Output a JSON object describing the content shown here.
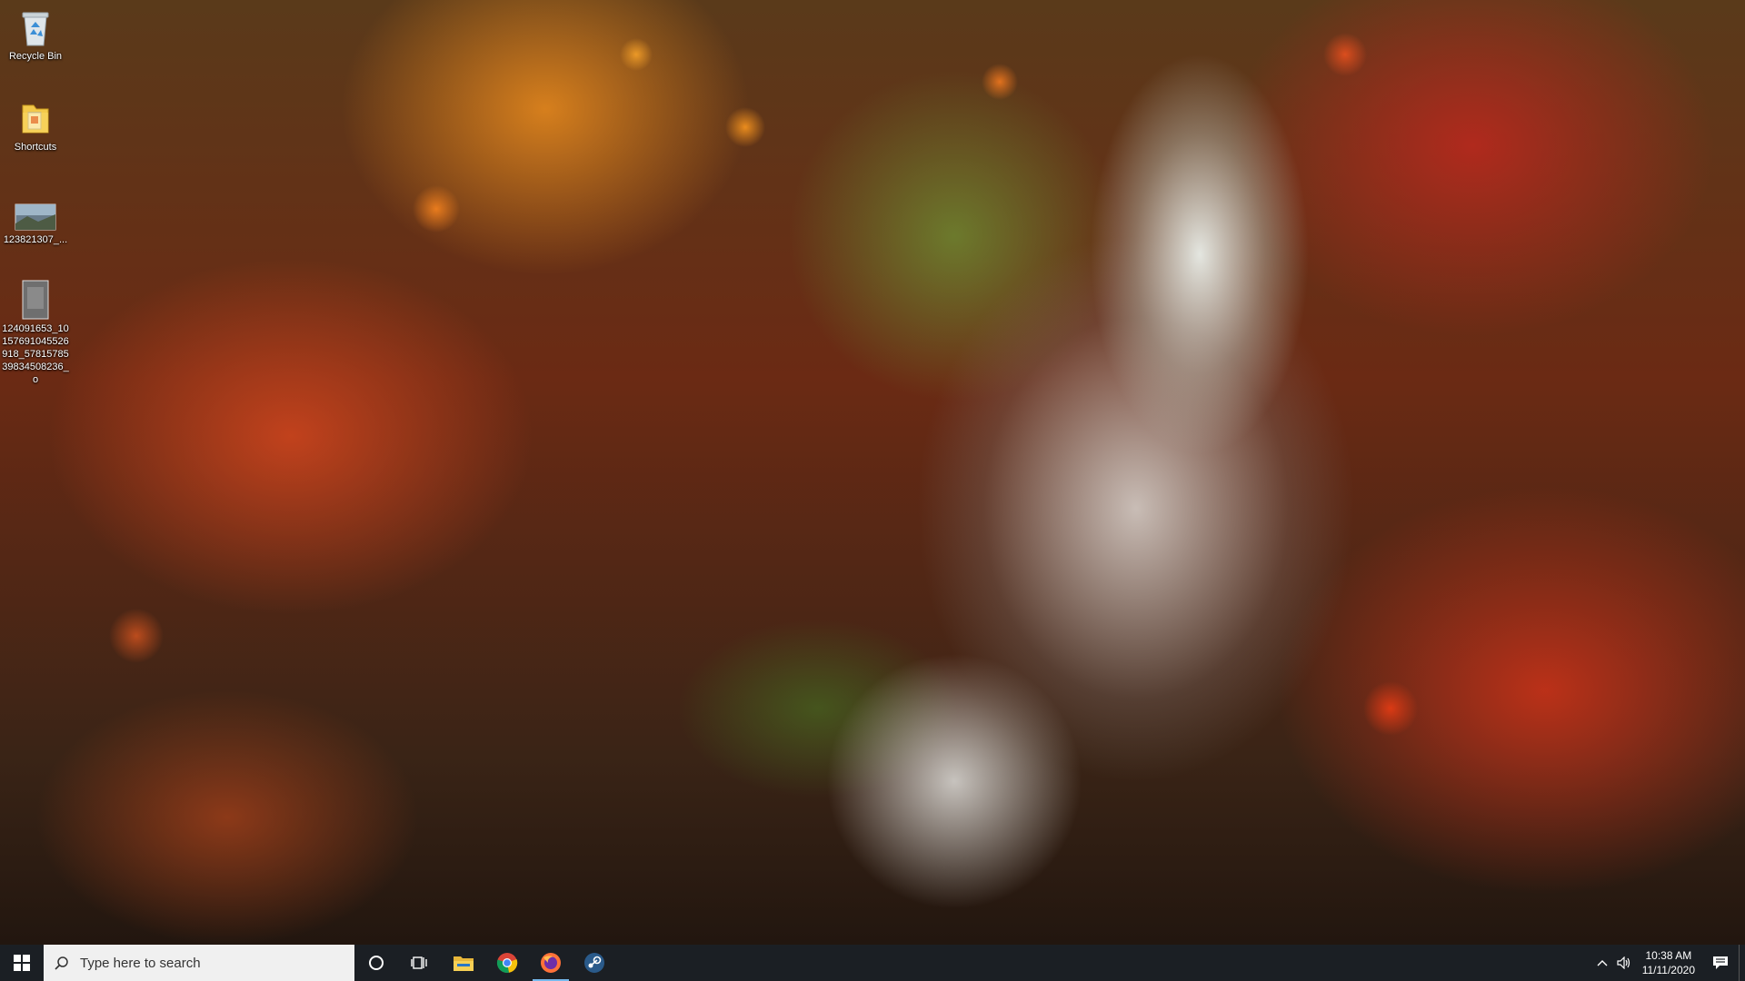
{
  "desktop": {
    "icons": [
      {
        "label": "Recycle Bin",
        "icon": "recycle-bin-icon"
      },
      {
        "label": "Shortcuts",
        "icon": "folder-icon"
      },
      {
        "label": "123821307_...",
        "icon": "image-file-icon"
      },
      {
        "label": "124091653_10157691045526918_5781578539834508236_o",
        "icon": "image-file-icon"
      }
    ]
  },
  "taskbar": {
    "search_placeholder": "Type here to search",
    "pinned": [
      {
        "name": "cortana",
        "icon": "cortana-circle-icon"
      },
      {
        "name": "task-view",
        "icon": "task-view-icon"
      },
      {
        "name": "file-explorer",
        "icon": "folder-icon"
      },
      {
        "name": "chrome",
        "icon": "chrome-icon"
      },
      {
        "name": "firefox",
        "icon": "firefox-icon",
        "active": true
      },
      {
        "name": "steam",
        "icon": "steam-icon"
      }
    ],
    "clock": {
      "time": "10:38 AM",
      "date": "11/11/2020"
    }
  },
  "colors": {
    "taskbar_bg": "#1b1f24",
    "search_bg": "#f0f0f0",
    "active_indicator": "#76b9ed"
  }
}
